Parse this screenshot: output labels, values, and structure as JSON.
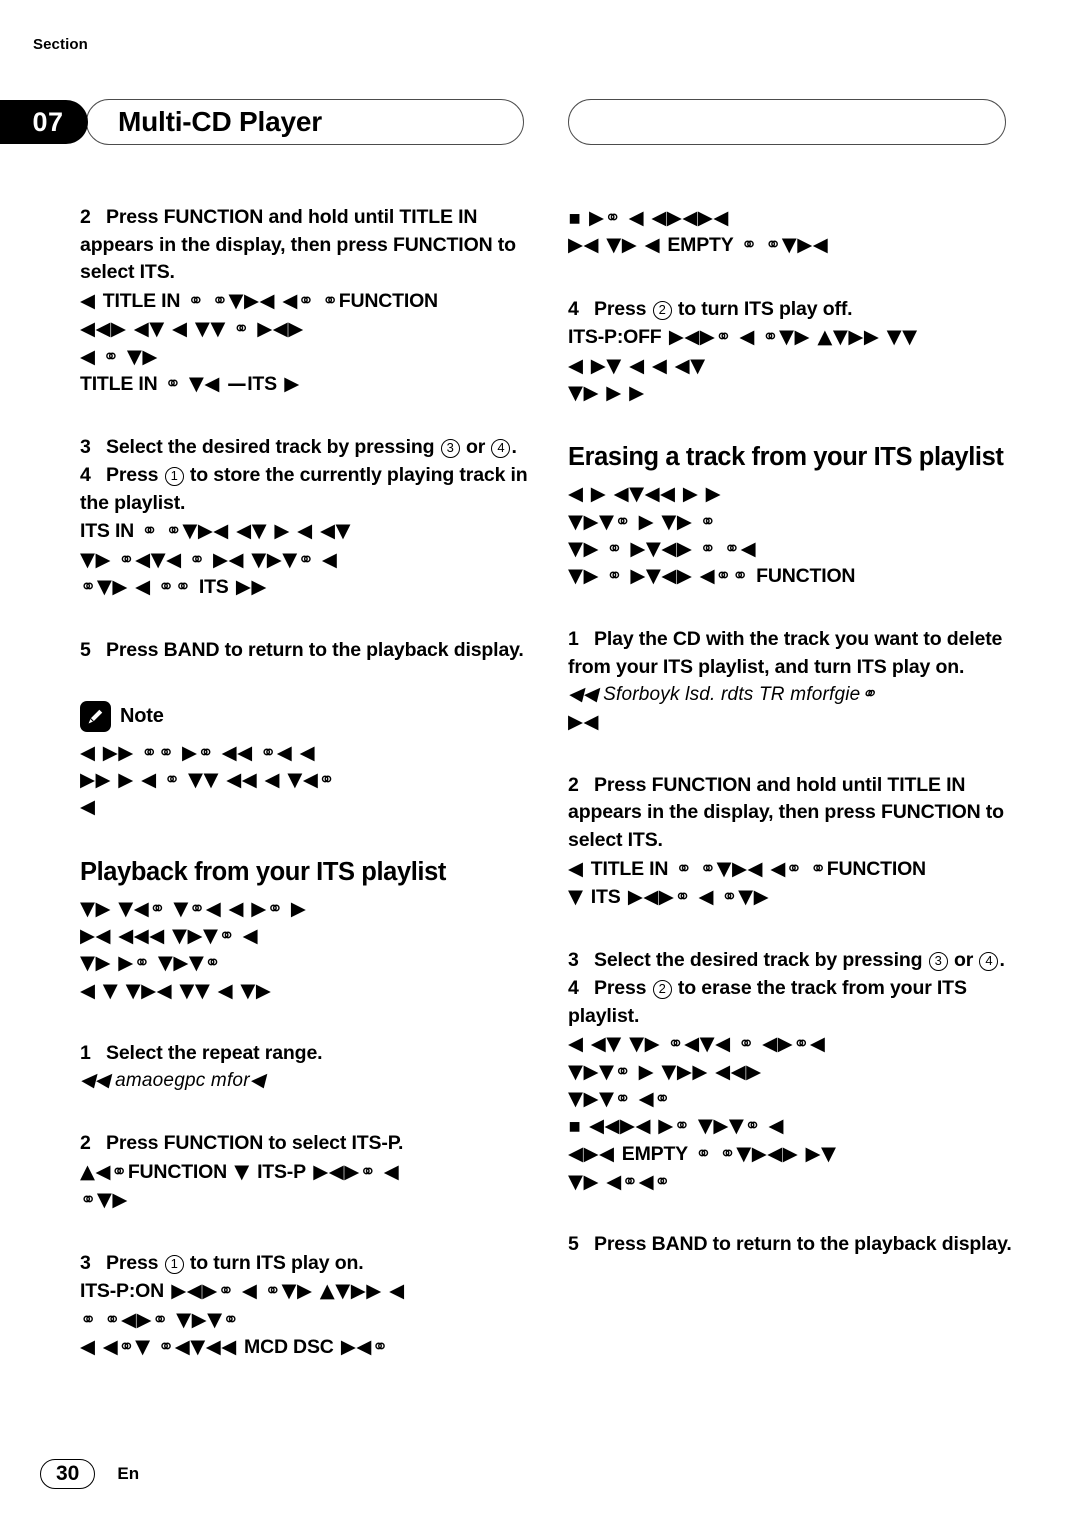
{
  "header": {
    "section_word": "Section",
    "section_number": "07",
    "title": "Multi-CD Player",
    "right_pill_title": ""
  },
  "left_column": {
    "blocks": [
      {
        "type": "step",
        "number": "2",
        "text": "Press FUNCTION and hold until TITLE IN appears in the display, then press FUNCTION to select ITS."
      },
      {
        "type": "glyph",
        "lines": [
          "◀      TITLE IN ⚭ ⚭▼▶◀ ◀⚭ ⚭FUNCTION",
          "◀◀▶ ◀▼ ◀ ▼▼ ⚭ ▶◀▶",
          "◀ ⚭ ▼▶",
          "TITLE IN ⚭ ▼◀          —ITS  ▶"
        ]
      },
      {
        "type": "step",
        "number": "3",
        "text": "Select the desired track by pressing ③ or ④."
      },
      {
        "type": "step",
        "number": "4",
        "text": "Press ① to store the currently playing track in the playlist."
      },
      {
        "type": "glyph",
        "lines": [
          "ITS IN ⚭ ⚭▼▶◀ ◀▼ ▶ ◀ ◀▼",
          "▼▶ ⚭◀▼◀ ⚭ ▶◀  ▼▶▼⚭ ◀",
          "⚭▼▶ ◀ ⚭⚭     ITS ▶▶"
        ]
      },
      {
        "type": "step",
        "number": "5",
        "text": "Press BAND to return to the playback display."
      },
      {
        "type": "note",
        "label": "Note",
        "icon": "pencil-icon"
      },
      {
        "type": "glyph",
        "lines": [
          "◀ ▶▶   ⚭⚭ ▶⚭ ◀◀ ⚭◀  ◀",
          "▶▶  ▶ ◀ ⚭ ▼▼ ◀◀ ◀ ▼◀⚭",
          "◀"
        ]
      },
      {
        "type": "heading",
        "text": "Playback from your ITS playlist"
      },
      {
        "type": "glyph",
        "lines": [
          "▼▶ ▼◀⚭  ▼⚭◀ ◀ ▶⚭ ▶",
          "▶◀ ◀◀◀  ▼▶▼⚭ ◀",
          "  ▼▶ ▶⚭    ▼▶▼⚭",
          "◀ ▼ ▼▶◀ ▼▼ ◀ ▼▶"
        ]
      },
      {
        "type": "step",
        "number": "1",
        "text": "Select the repeat range."
      },
      {
        "type": "italic",
        "text": "◀◀        amaoegpc mfor◀"
      },
      {
        "type": "step",
        "number": "2",
        "text": "Press FUNCTION to select ITS-P."
      },
      {
        "type": "glyph",
        "lines": [
          "▲◀⚭FUNCTION ▼    ITS-P ▶◀▶⚭  ◀",
          "⚭▼▶"
        ]
      },
      {
        "type": "step",
        "number": "3",
        "text": "Press ① to turn ITS play on."
      },
      {
        "type": "glyph",
        "lines": [
          "ITS-P:ON ▶◀▶⚭  ◀ ⚭▼▶ ▲▼▶▶ ◀",
          "⚭ ⚭◀▶⚭  ▼▶▼⚭",
          "◀ ◀⚭▼ ⚭◀▼◀◀    MCD    DSC ▶◀⚭"
        ]
      }
    ]
  },
  "right_column": {
    "blocks": [
      {
        "type": "glyph",
        "lines": [
          "▪   ▶⚭ ◀ ◀▶◀▶◀",
          "▶◀  ▼▶ ◀                    EMPTY ⚭ ⚭▼▶◀"
        ]
      },
      {
        "type": "step",
        "number": "4",
        "text": "Press ② to turn ITS play off."
      },
      {
        "type": "glyph",
        "lines": [
          "ITS-P:OFF ▶◀▶⚭  ◀ ⚭▼▶ ▲▼▶▶ ▼▼",
          "◀ ▶▼ ◀  ◀ ◀▼",
          "▼▶ ▶ ▶"
        ]
      },
      {
        "type": "heading",
        "text": "Erasing a track from your ITS playlist"
      },
      {
        "type": "glyph",
        "lines": [
          "◀ ▶ ◀▼◀◀ ▶ ▶",
          "▼▶▼⚭ ▶ ▼▶ ⚭",
          " ▼▶ ⚭ ▶▼◀▶ ⚭ ⚭◀",
          "▼▶ ⚭ ▶▼◀▶ ◀⚭⚭     FUNCTION"
        ]
      },
      {
        "type": "step",
        "number": "1",
        "text": "Play the CD with the track you want to delete from your ITS playlist, and turn ITS play on."
      },
      {
        "type": "italic",
        "text": "◀◀       Sforboyk lsd. rdts TR   mforfgie⚭"
      },
      {
        "type": "glyph",
        "lines": [
          "▶◀"
        ]
      },
      {
        "type": "step",
        "number": "2",
        "text": "Press FUNCTION and hold until TITLE IN appears in the display, then press FUNCTION to select ITS."
      },
      {
        "type": "glyph",
        "lines": [
          "◀      TITLE IN ⚭ ⚭▼▶◀ ◀⚭ ⚭FUNCTION",
          "▼     ITS ▶◀▶⚭  ◀ ⚭▼▶"
        ]
      },
      {
        "type": "step",
        "number": "3",
        "text": "Select the desired track by pressing ③ or ④."
      },
      {
        "type": "step",
        "number": "4",
        "text": "Press ② to erase the track from your ITS playlist."
      },
      {
        "type": "glyph",
        "lines": [
          "◀ ◀▼ ▼▶ ⚭◀▼◀ ⚭ ◀▶⚭◀",
          " ▼▶▼⚭ ▶ ▼▶▶ ◀◀▶",
          "  ▼▶▼⚭ ◀⚭",
          "▪   ◀◀▶◀ ▶⚭  ▼▶▼⚭  ◀",
          "◀▶◀           EMPTY ⚭ ⚭▼▶◀▶ ▶▼",
          "▼▶ ◀⚭◀⚭"
        ]
      },
      {
        "type": "step",
        "number": "5",
        "text": "Press BAND to return to the playback display."
      }
    ]
  },
  "footer": {
    "page_number": "30",
    "language": "En"
  }
}
